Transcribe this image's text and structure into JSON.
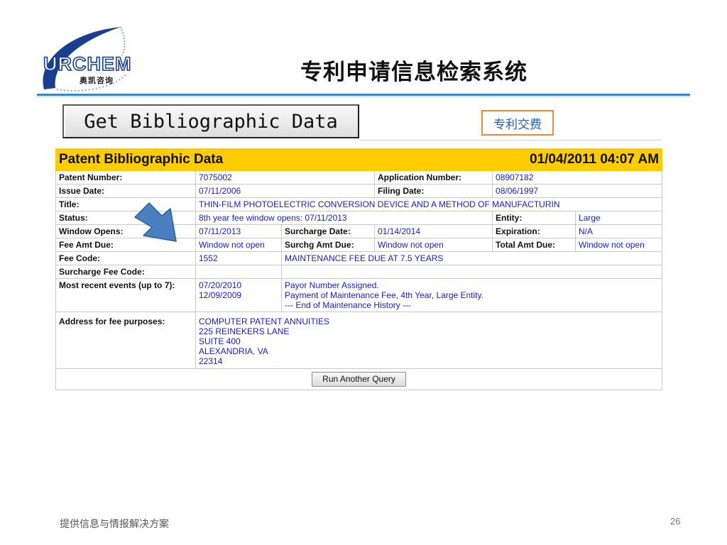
{
  "logo": {
    "word": "URCHEM",
    "sub": "奥凯咨询"
  },
  "slide_title": "专利申请信息检索系统",
  "get_button": "Get Bibliographic Data",
  "fee_link": "专利交费",
  "table": {
    "heading": "Patent Bibliographic Data",
    "datetime": "01/04/2011 04:07 AM",
    "patent_number_label": "Patent Number:",
    "patent_number": "7075002",
    "application_number_label": "Application Number:",
    "application_number": "08907182",
    "issue_date_label": "Issue Date:",
    "issue_date": "07/11/2006",
    "filing_date_label": "Filing Date:",
    "filing_date": "08/06/1997",
    "title_label": "Title:",
    "title": "THIN-FILM PHOTOELECTRIC CONVERSION DEVICE AND A METHOD OF MANUFACTURIN",
    "status_label": "Status:",
    "status": "8th year fee window opens: 07/11/2013",
    "entity_label": "Entity:",
    "entity": "Large",
    "window_opens_label": "Window Opens:",
    "window_opens": "07/11/2013",
    "surcharge_date_label": "Surcharge Date:",
    "surcharge_date": "01/14/2014",
    "expiration_label": "Expiration:",
    "expiration": "N/A",
    "fee_amt_due_label": "Fee Amt Due:",
    "fee_amt_due": "Window not open",
    "surchg_amt_due_label": "Surchg Amt Due:",
    "surchg_amt_due": "Window not open",
    "total_amt_due_label": "Total Amt Due:",
    "total_amt_due": "Window not open",
    "fee_code_label": "Fee Code:",
    "fee_code": "1552",
    "fee_code_desc": "MAINTENANCE FEE DUE AT 7.5 YEARS",
    "surcharge_fee_code_label": "Surcharge Fee Code:",
    "events_label": "Most recent events (up to 7):",
    "events": [
      {
        "date": "07/20/2010",
        "desc": "Payor Number Assigned."
      },
      {
        "date": "12/09/2009",
        "desc": "Payment of Maintenance Fee, 4th Year, Large Entity."
      }
    ],
    "events_end": "--- End of Maintenance History ---",
    "address_label": "Address for fee purposes:",
    "address_lines": [
      "COMPUTER PATENT ANNUITIES",
      "225 REINEKERS LANE",
      "SUITE 400",
      "ALEXANDRIA, VA",
      "22314"
    ],
    "run_button": "Run Another Query"
  },
  "footer": "提供信息与情报解决方案",
  "page_number": "26",
  "colors": {
    "header_bar": "#ffcc00",
    "value_text": "#1a1ad0",
    "rule": "#3a87c4",
    "fee_border": "#ee8a34",
    "arrow": "#4a7fc1"
  }
}
